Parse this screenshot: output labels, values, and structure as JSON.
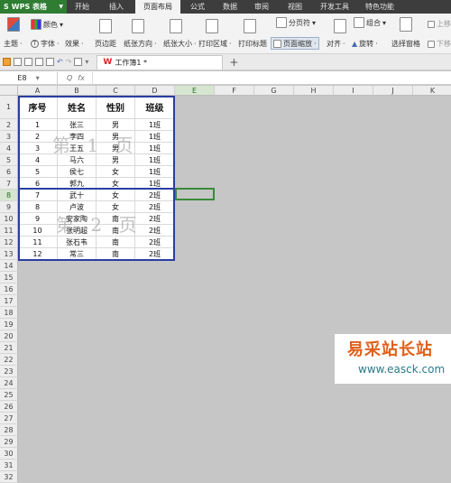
{
  "app": {
    "name": "WPS 表格"
  },
  "menu": [
    "开始",
    "插入",
    "页面布局",
    "公式",
    "数据",
    "审阅",
    "视图",
    "开发工具",
    "特色功能"
  ],
  "menu_active_index": 2,
  "toolbar": {
    "theme": "主题",
    "colors": "颜色",
    "fonts": "字体",
    "effects": "效果",
    "margins": "页边距",
    "orientation": "纸张方向",
    "size": "纸张大小",
    "print_area": "打印区域",
    "print_titles": "打印标题",
    "page_scale": "页面缩放",
    "page_break": "分页符",
    "group": "组合",
    "align": "对齐",
    "rotate": "旋转",
    "selection_pane": "选择窗格",
    "move_up": "上移",
    "move_down": "下移"
  },
  "document_tab": {
    "title": "工作簿1 *",
    "badge": "W"
  },
  "formula_bar": {
    "name_box": "E8",
    "fx": "fx",
    "magnifier": "Q"
  },
  "columns": [
    "A",
    "B",
    "C",
    "D",
    "E",
    "F",
    "G",
    "H",
    "I",
    "J",
    "K"
  ],
  "selected_column": "E",
  "rows": [
    "1",
    "2",
    "3",
    "4",
    "5",
    "6",
    "7",
    "8",
    "9",
    "10",
    "11",
    "12",
    "13",
    "14",
    "15",
    "16",
    "17",
    "18",
    "19",
    "20",
    "21",
    "22",
    "23",
    "24",
    "25",
    "26",
    "27",
    "28",
    "29",
    "30",
    "31",
    "32"
  ],
  "selected_row": "8",
  "table": {
    "headers": [
      "序号",
      "姓名",
      "性别",
      "班级"
    ],
    "rows": [
      [
        "1",
        "张三",
        "男",
        "1班"
      ],
      [
        "2",
        "李四",
        "男",
        "1班"
      ],
      [
        "3",
        "王五",
        "男",
        "1班"
      ],
      [
        "4",
        "马六",
        "男",
        "1班"
      ],
      [
        "5",
        "侯七",
        "女",
        "1班"
      ],
      [
        "6",
        "郭九",
        "女",
        "1班"
      ],
      [
        "7",
        "武十",
        "女",
        "2班"
      ],
      [
        "8",
        "卢波",
        "女",
        "2班"
      ],
      [
        "9",
        "安家陶",
        "南",
        "2班"
      ],
      [
        "10",
        "张明超",
        "南",
        "2班"
      ],
      [
        "11",
        "张石韦",
        "南",
        "2班"
      ],
      [
        "12",
        "常三",
        "南",
        "2班"
      ]
    ]
  },
  "watermarks": {
    "page1": "第 1 页",
    "page2": "第 2 页"
  },
  "branding": {
    "line1": "易采站长站",
    "line2": "www.easck.com"
  }
}
